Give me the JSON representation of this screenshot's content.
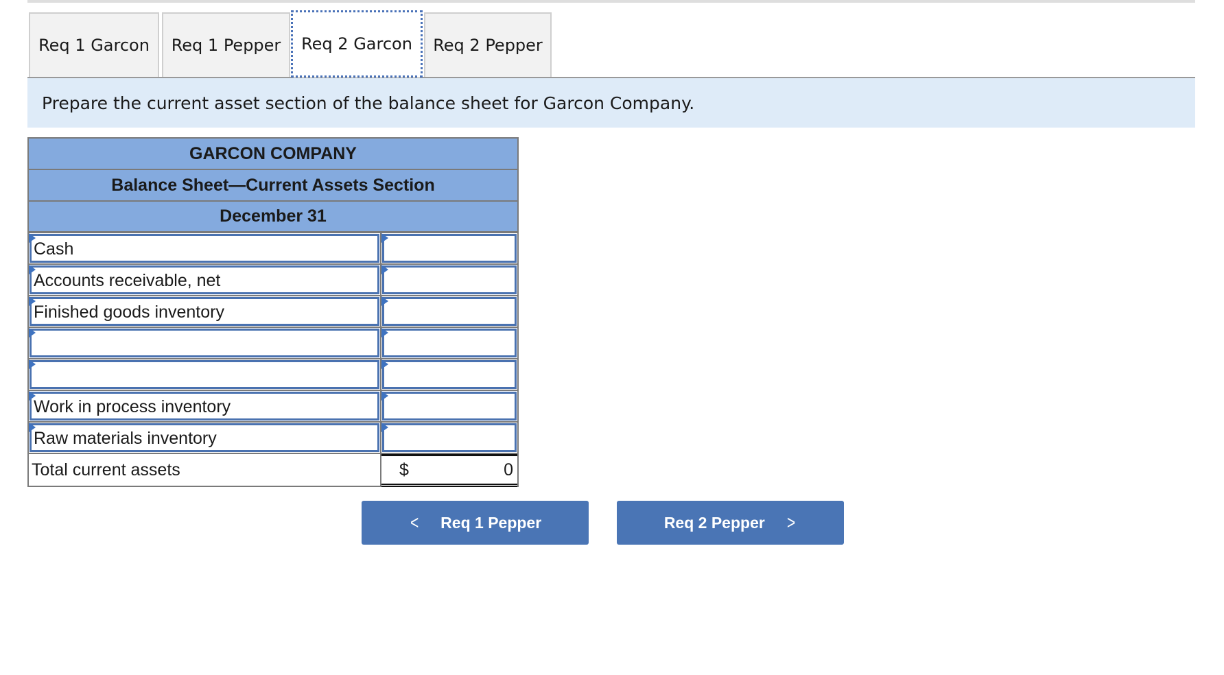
{
  "tabs": [
    {
      "label": "Req 1 Garcon",
      "active": false
    },
    {
      "label": "Req 1 Pepper",
      "active": false
    },
    {
      "label": "Req 2 Garcon",
      "active": true
    },
    {
      "label": "Req 2 Pepper",
      "active": false
    }
  ],
  "instruction": "Prepare the current asset section of the balance sheet for Garcon Company.",
  "sheet": {
    "company": "GARCON COMPANY",
    "title": "Balance Sheet—Current Assets Section",
    "date": "December 31",
    "rows": [
      {
        "label": "Cash",
        "amount": ""
      },
      {
        "label": "Accounts receivable, net",
        "amount": ""
      },
      {
        "label": "Finished goods inventory",
        "amount": ""
      },
      {
        "label": "",
        "amount": ""
      },
      {
        "label": "",
        "amount": ""
      },
      {
        "label": "Work in process inventory",
        "amount": ""
      },
      {
        "label": "Raw materials inventory",
        "amount": ""
      }
    ],
    "total": {
      "label": "Total current assets",
      "currency": "$",
      "value": "0"
    }
  },
  "nav": {
    "prev_label": "Req 1 Pepper",
    "next_label": "Req 2 Pepper",
    "prev_icon": "chevron-left-icon",
    "next_icon": "chevron-right-icon"
  },
  "colors": {
    "header_blue": "#84aade",
    "instruction_bg": "#deebf8",
    "button_blue": "#4a75b5",
    "input_border": "#4a72b0"
  }
}
